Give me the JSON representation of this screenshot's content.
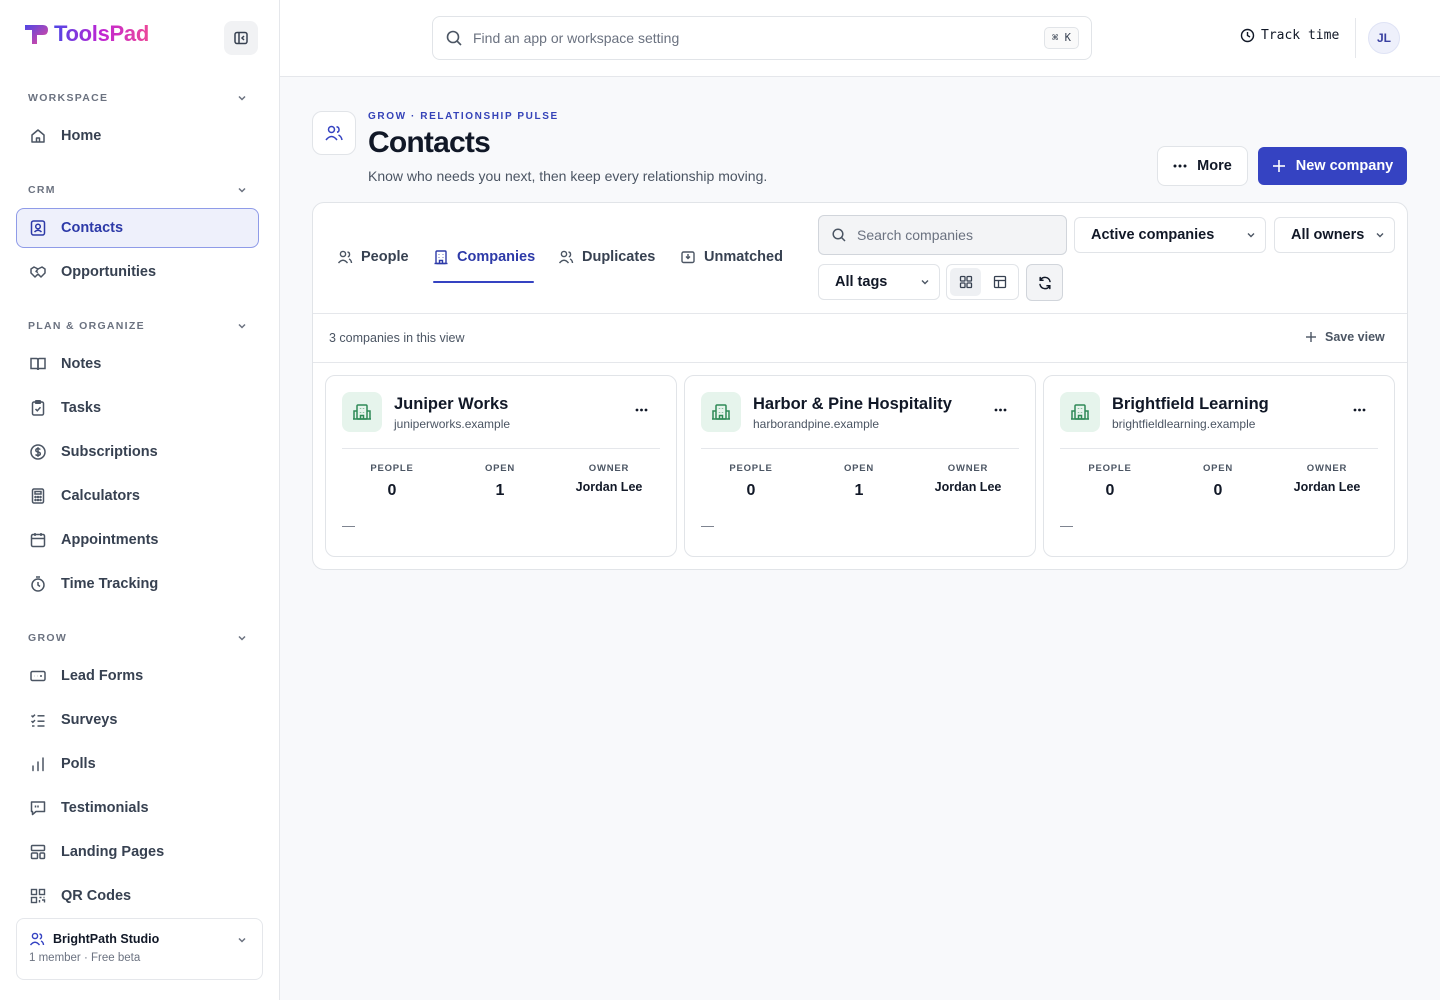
{
  "brand": {
    "name": "ToolsPad"
  },
  "sidebar": {
    "sections": [
      {
        "title": "WORKSPACE",
        "items": [
          {
            "label": "Home",
            "icon": "home-icon"
          }
        ]
      },
      {
        "title": "CRM",
        "items": [
          {
            "label": "Contacts",
            "icon": "contacts-icon",
            "active": true
          },
          {
            "label": "Opportunities",
            "icon": "handshake-icon"
          }
        ]
      },
      {
        "title": "PLAN & ORGANIZE",
        "items": [
          {
            "label": "Notes",
            "icon": "notes-icon"
          },
          {
            "label": "Tasks",
            "icon": "clipboard-check-icon"
          },
          {
            "label": "Subscriptions",
            "icon": "dollar-circle-icon"
          },
          {
            "label": "Calculators",
            "icon": "calculator-icon"
          },
          {
            "label": "Appointments",
            "icon": "calendar-icon"
          },
          {
            "label": "Time Tracking",
            "icon": "stopwatch-icon"
          }
        ]
      },
      {
        "title": "GROW",
        "items": [
          {
            "label": "Lead Forms",
            "icon": "form-icon"
          },
          {
            "label": "Surveys",
            "icon": "checklist-icon"
          },
          {
            "label": "Polls",
            "icon": "bar-chart-icon"
          },
          {
            "label": "Testimonials",
            "icon": "quote-message-icon"
          },
          {
            "label": "Landing Pages",
            "icon": "layout-icon"
          },
          {
            "label": "QR Codes",
            "icon": "qr-code-icon"
          }
        ]
      }
    ],
    "workspace": {
      "name": "BrightPath Studio",
      "meta": "1 member · Free beta"
    }
  },
  "topbar": {
    "search_placeholder": "Find an app or workspace setting",
    "shortcut": "⌘ K",
    "track_label": "Track time",
    "avatar_initials": "JL"
  },
  "header": {
    "eyebrow": "GROW · RELATIONSHIP PULSE",
    "title": "Contacts",
    "subtitle": "Know who needs you next, then keep every relationship moving.",
    "more_label": "More",
    "new_label": "New company"
  },
  "tabs": [
    {
      "label": "People",
      "icon": "people-icon"
    },
    {
      "label": "Companies",
      "icon": "building-icon",
      "active": true
    },
    {
      "label": "Duplicates",
      "icon": "people-icon"
    },
    {
      "label": "Unmatched",
      "icon": "inbox-icon"
    }
  ],
  "filters": {
    "search_placeholder": "Search companies",
    "status": "Active companies",
    "owner": "All owners",
    "tags": "All tags"
  },
  "list": {
    "count_text": "3 companies in this view",
    "save_view_label": "Save view",
    "stat_labels": {
      "people": "PEOPLE",
      "open": "OPEN",
      "owner": "OWNER"
    },
    "companies": [
      {
        "name": "Juniper Works",
        "domain": "juniperworks.example",
        "people": "0",
        "open": "1",
        "owner": "Jordan Lee",
        "note": "—"
      },
      {
        "name": "Harbor & Pine Hospitality",
        "domain": "harborandpine.example",
        "people": "0",
        "open": "1",
        "owner": "Jordan Lee",
        "note": "—"
      },
      {
        "name": "Brightfield Learning",
        "domain": "brightfieldlearning.example",
        "people": "0",
        "open": "0",
        "owner": "Jordan Lee",
        "note": "—"
      }
    ]
  },
  "colors": {
    "accent": "#3543c2",
    "company_icon_bg": "#e6f4ec",
    "company_icon": "#2f8a57"
  }
}
